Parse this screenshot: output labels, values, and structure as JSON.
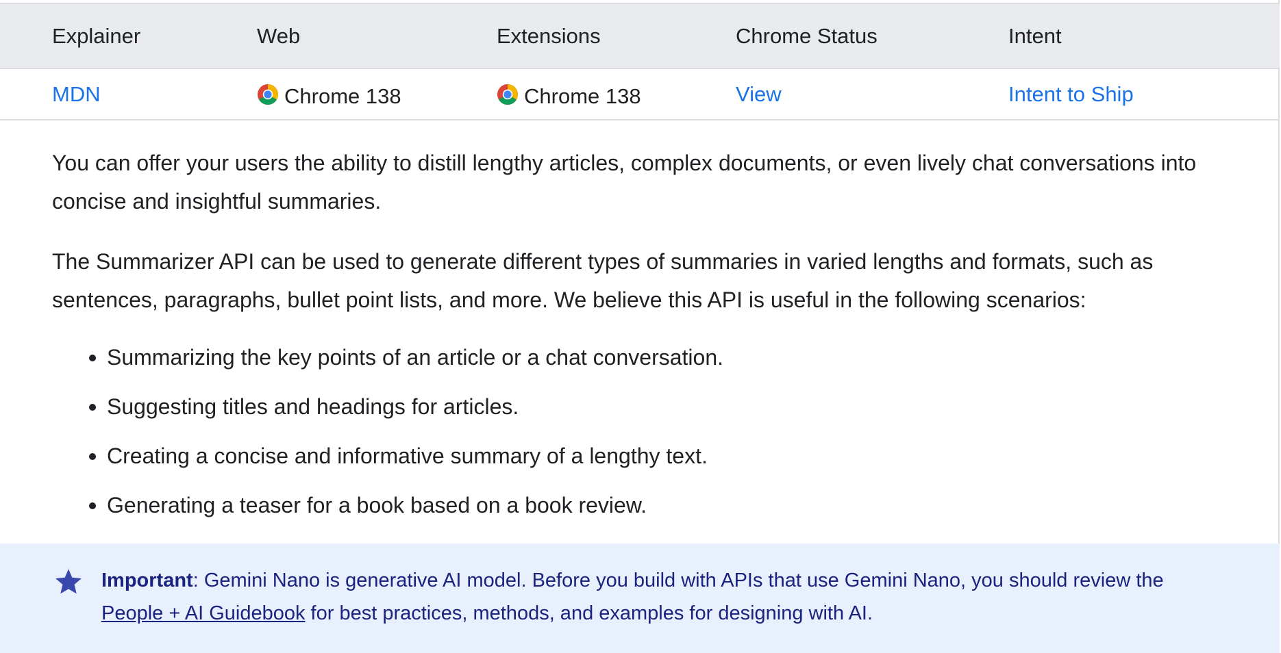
{
  "table": {
    "headers": [
      "Explainer",
      "Web",
      "Extensions",
      "Chrome Status",
      "Intent"
    ],
    "row": {
      "explainer": "MDN",
      "web": "Chrome 138",
      "extensions": "Chrome 138",
      "chrome_status": "View",
      "intent": "Intent to Ship"
    },
    "icon": "chrome-icon"
  },
  "paragraphs": [
    "You can offer your users the ability to distill lengthy articles, complex documents, or even lively chat conversations into concise and insightful summaries.",
    "The Summarizer API can be used to generate different types of summaries in varied lengths and formats, such as sentences, paragraphs, bullet point lists, and more. We believe this API is useful in the following scenarios:"
  ],
  "bullets": [
    "Summarizing the key points of an article or a chat conversation.",
    "Suggesting titles and headings for articles.",
    "Creating a concise and informative summary of a lengthy text.",
    "Generating a teaser for a book based on a book review."
  ],
  "callout": {
    "icon": "star-icon",
    "label": "Important",
    "text_before": ": Gemini Nano is generative AI model. Before you build with APIs that use Gemini Nano, you should review the ",
    "link": "People + AI Guidebook",
    "text_after": " for best practices, methods, and examples for designing with AI."
  },
  "colors": {
    "link": "#1a73e8",
    "callout_bg": "#e8f0fe",
    "callout_text": "#1a237e",
    "table_header_bg": "#e8eaed"
  }
}
